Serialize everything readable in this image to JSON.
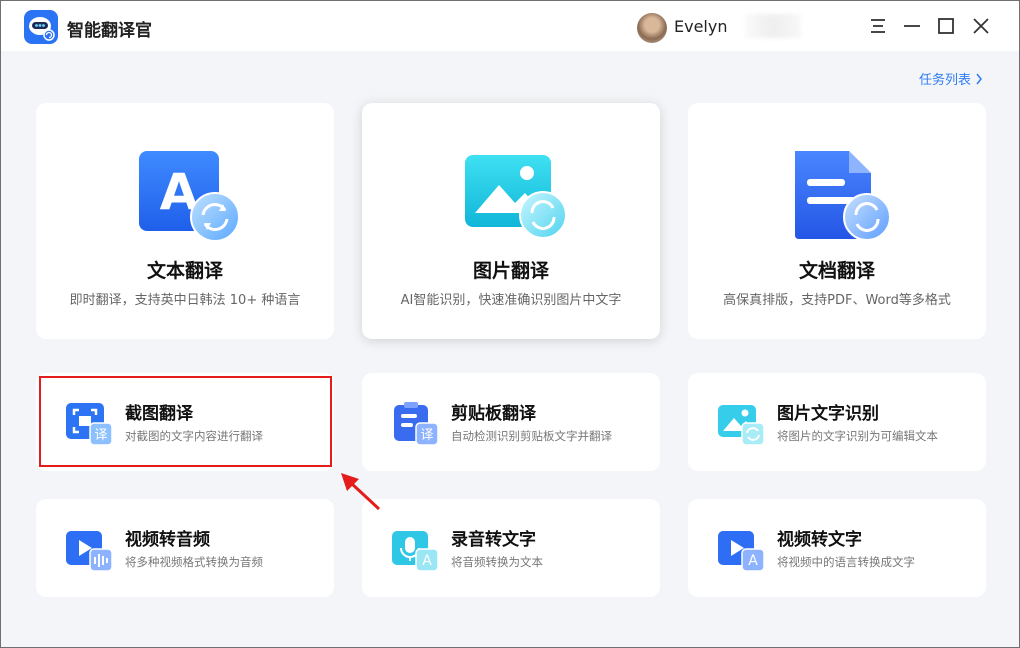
{
  "app": {
    "title": "智能翻译官"
  },
  "user": {
    "name": "Evelyn"
  },
  "header": {
    "task_list": "任务列表"
  },
  "features_large": [
    {
      "title": "文本翻译",
      "desc": "即时翻译，支持英中日韩法 10+ 种语言",
      "icon": "text-translate-icon"
    },
    {
      "title": "图片翻译",
      "desc": "AI智能识别，快速准确识别图片中文字",
      "icon": "image-translate-icon"
    },
    {
      "title": "文档翻译",
      "desc": "高保真排版，支持PDF、Word等多格式",
      "icon": "document-translate-icon"
    }
  ],
  "features_small": [
    {
      "title": "截图翻译",
      "desc": "对截图的文字内容进行翻译",
      "icon": "screenshot-translate-icon",
      "badge": "译"
    },
    {
      "title": "剪贴板翻译",
      "desc": "自动检测识别剪贴板文字并翻译",
      "icon": "clipboard-translate-icon",
      "badge": "译"
    },
    {
      "title": "图片文字识别",
      "desc": "将图片的文字识别为可编辑文本",
      "icon": "image-ocr-icon"
    },
    {
      "title": "视频转音频",
      "desc": "将多种视频格式转换为音频",
      "icon": "video-to-audio-icon"
    },
    {
      "title": "录音转文字",
      "desc": "将音频转换为文本",
      "icon": "audio-to-text-icon",
      "badge": "A"
    },
    {
      "title": "视频转文字",
      "desc": "将视频中的语言转换成文字",
      "icon": "video-to-text-icon",
      "badge": "A"
    }
  ],
  "colors": {
    "accent": "#2f7cf6",
    "highlight": "#e51c1c",
    "background": "#f3f5f8"
  }
}
